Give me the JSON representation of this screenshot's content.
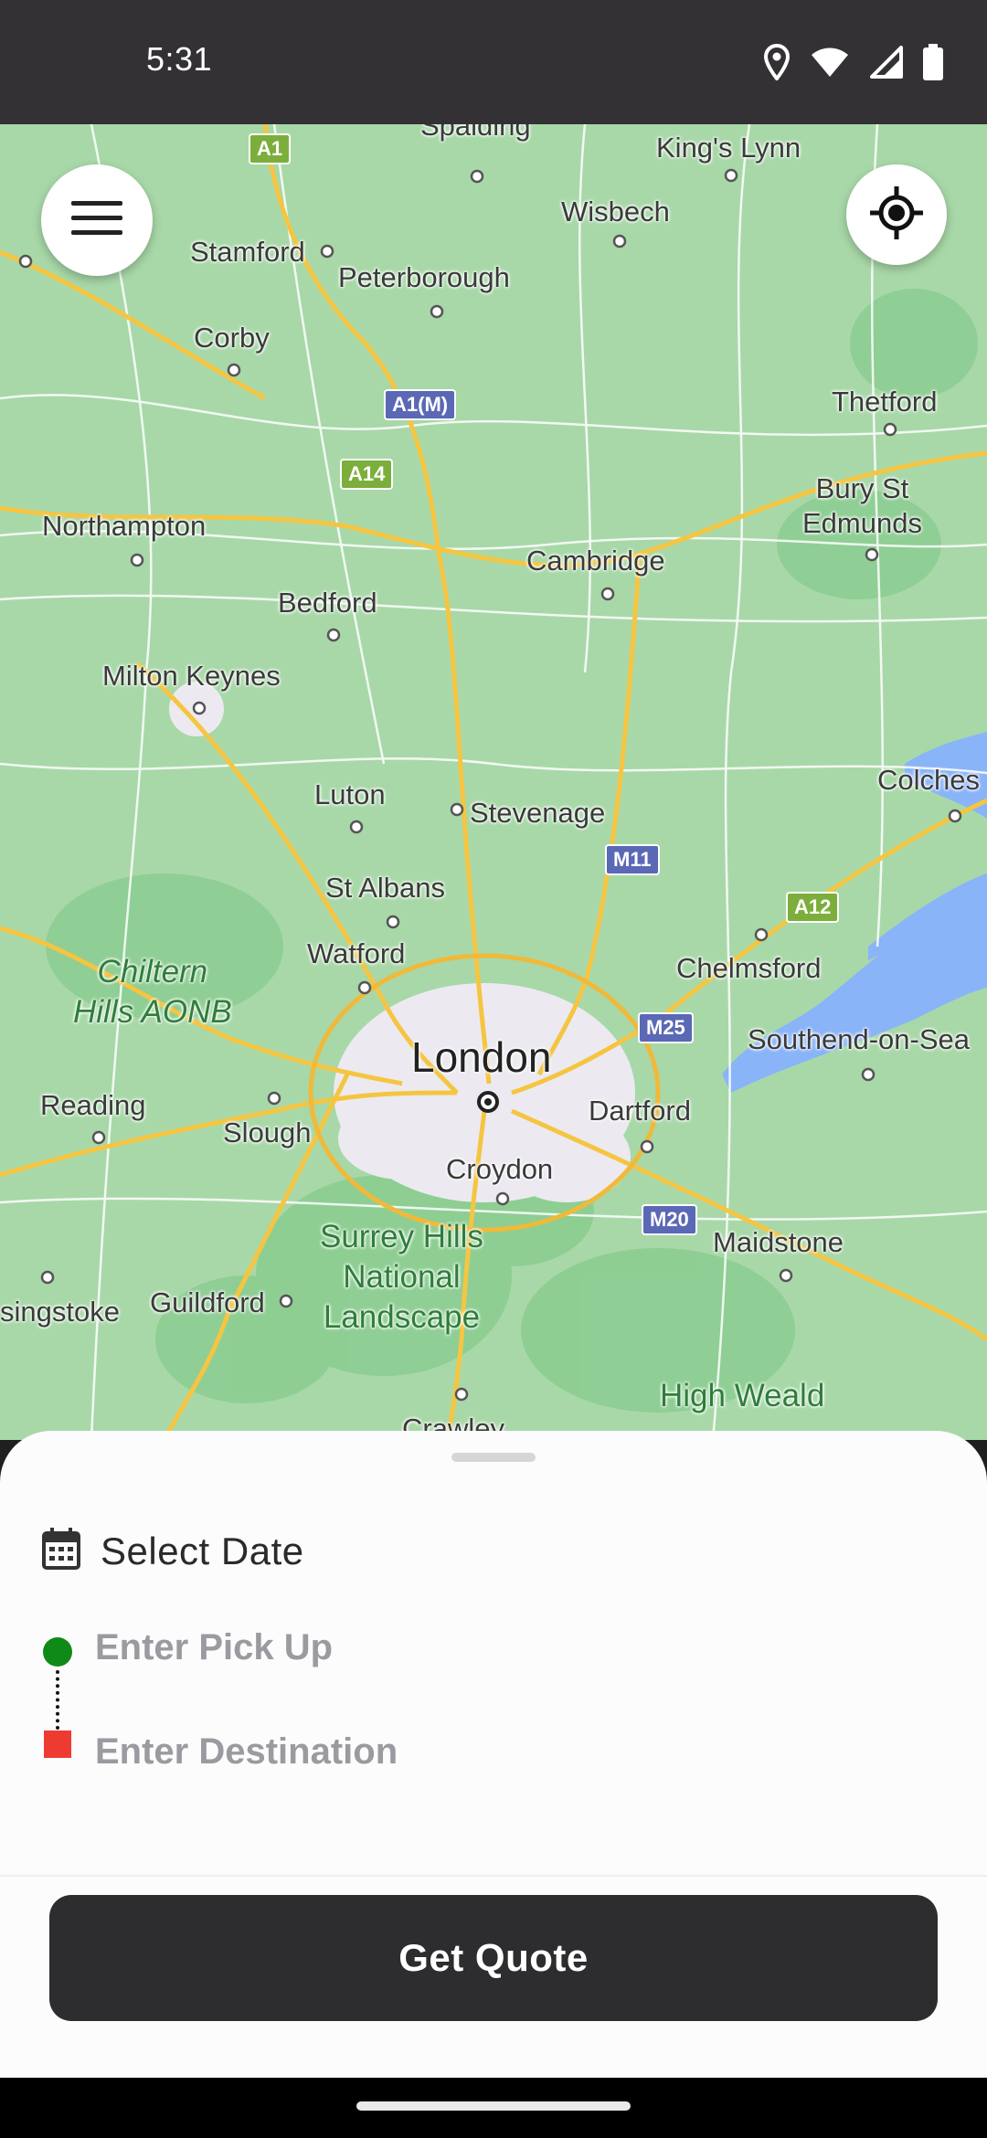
{
  "status_bar": {
    "time": "5:31",
    "icons": [
      "location-icon",
      "wifi-icon",
      "signal-icon",
      "battery-icon"
    ]
  },
  "map": {
    "colors": {
      "land": "#a8d8a8",
      "water": "#8ab4f8",
      "major_road": "#f5c542",
      "urban": "#eceaf0"
    },
    "labels": {
      "kings_lynn": "King's Lynn",
      "wisbech": "Wisbech",
      "stamford": "Stamford",
      "peterborough": "Peterborough",
      "corby": "Corby",
      "thetford": "Thetford",
      "bury_st_edmunds": "Bury St\nEdmunds",
      "northampton": "Northampton",
      "cambridge": "Cambridge",
      "bedford": "Bedford",
      "milton_keynes": "Milton Keynes",
      "luton": "Luton",
      "stevenage": "Stevenage",
      "colchester": "Colches",
      "st_albans": "St Albans",
      "watford": "Watford",
      "chelmsford": "Chelmsford",
      "chiltern": "Chiltern\nHills AONB",
      "london": "London",
      "southend": "Southend-on-Sea",
      "reading": "Reading",
      "slough": "Slough",
      "dartford": "Dartford",
      "croydon": "Croydon",
      "surrey_hills": "Surrey Hills\nNational\nLandscape",
      "maidstone": "Maidstone",
      "basingstoke": "singstoke",
      "guildford": "Guildford",
      "high_weald": "High Weald",
      "crawley": "Crawley",
      "spalding": "Spalding"
    },
    "shields": {
      "a1": "A1",
      "a1m": "A1(M)",
      "a14": "A14",
      "m11": "M11",
      "a12": "A12",
      "m25": "M25",
      "m20": "M20"
    }
  },
  "controls": {
    "menu_icon": "hamburger-menu-icon",
    "locate_icon": "my-location-icon"
  },
  "sheet": {
    "date_icon": "calendar-icon",
    "date_label": "Select Date",
    "pickup_placeholder": "Enter Pick Up",
    "destination_placeholder": "Enter Destination",
    "pickup_color": "#0f8a18",
    "destination_color": "#ee3b32",
    "quote_button": "Get Quote"
  }
}
